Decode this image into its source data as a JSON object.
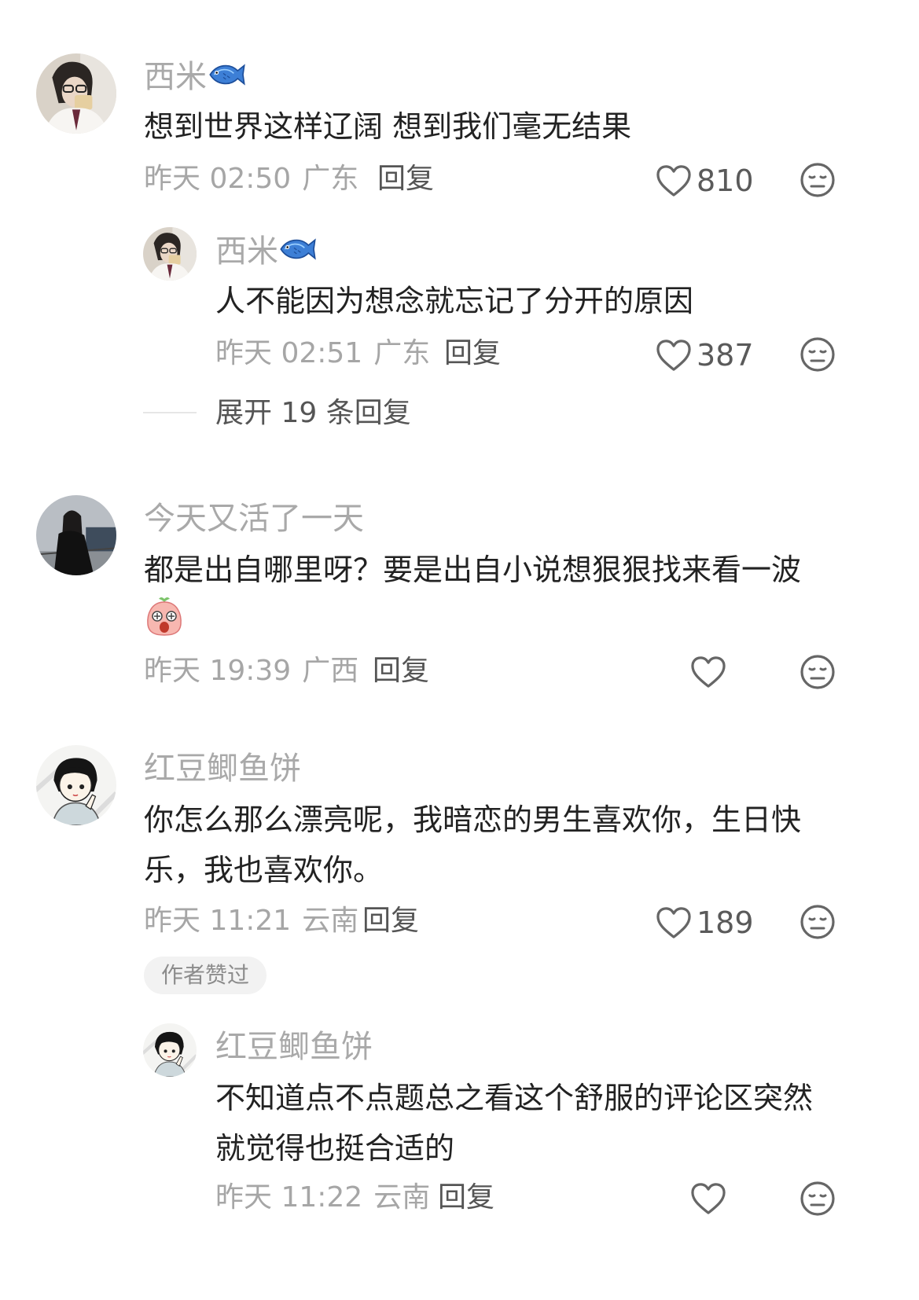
{
  "comments": [
    {
      "username": "西米",
      "text": "想到世界这样辽阔 想到我们毫无结果",
      "time": "昨天 02:50",
      "location": "广东",
      "reply_label": "回复",
      "likes": "810",
      "replies": [
        {
          "username": "西米",
          "text": "人不能因为想念就忘记了分开的原因",
          "time": "昨天 02:51",
          "location": "广东",
          "reply_label": "回复",
          "likes": "387"
        }
      ],
      "expand_label": "展开 19 条回复"
    },
    {
      "username": "今天又活了一天",
      "text": "都是出自哪里呀？要是出自小说想狠狠找来看一波",
      "emoji": "shocked-face-emoji",
      "time": "昨天 19:39",
      "location": "广西",
      "reply_label": "回复",
      "likes": ""
    },
    {
      "username": "红豆鲫鱼饼",
      "text_line1": "你怎么那么漂亮呢，我暗恋的男生喜欢你，生日快",
      "text_line2": "乐，我也喜欢你。",
      "time": "昨天 11:21",
      "location": "云南",
      "reply_label": "回复",
      "likes": "189",
      "badge": "作者赞过",
      "replies": [
        {
          "username": "红豆鲫鱼饼",
          "text_line1": "不知道点不点题总之看这个舒服的评论区突然",
          "text_line2": "就觉得也挺合适的",
          "time": "昨天 11:22",
          "location": "云南",
          "reply_label": "回复"
        }
      ]
    }
  ],
  "icons": {
    "like": "heart-outline-icon",
    "dislike": "neutral-face-icon",
    "user_badge": "fish-icon"
  }
}
